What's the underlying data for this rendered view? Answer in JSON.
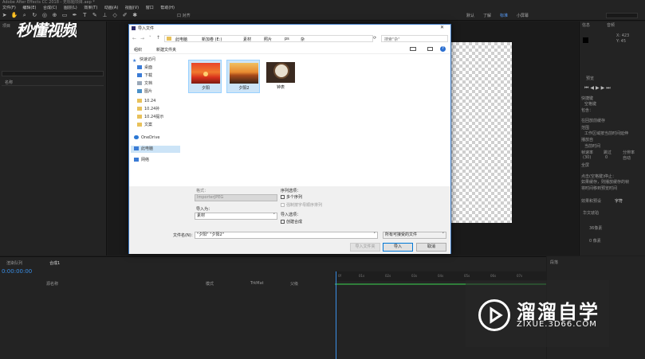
{
  "window": {
    "title": "Adobe After Effects CC 2018 - 无标题项目.aep *"
  },
  "menu": [
    "文件(F)",
    "编辑(E)",
    "合成(C)",
    "图层(L)",
    "效果(T)",
    "动画(A)",
    "视图(V)",
    "窗口",
    "帮助(H)"
  ],
  "toolbar": {
    "workspaces": [
      "默认",
      "了解",
      "标准",
      "小屏幕"
    ],
    "snap_label": "口 对齐"
  },
  "project_panel": {
    "tab": "项目",
    "name_header": "名称"
  },
  "right_panel": {
    "info_tab": "信息",
    "audio_tab": "音频",
    "info_x": "X: 423",
    "info_y": "Y: 45",
    "preview_tab": "预览",
    "shortcut_label": "快捷键",
    "shortcut_value": "空格键",
    "include_label": "包含：",
    "in_ram_label": "在回放前缓存",
    "range_label": "范围",
    "range_value": "工作区域按当前时间延伸",
    "play_from_label": "播放自",
    "play_from_value": "当前时间",
    "frame_rate_label": "帧速率",
    "skip_label": "跳过",
    "resolution_label": "分辨率",
    "fps_value": "(30)",
    "skip_value": "0",
    "res_value": "自动",
    "fullscreen_label": "全屏",
    "stop_label": "点击(空格键)停止：",
    "cache_label": "如果缓存，则播放缓存的帧",
    "move_time_label": "将时间移到预览时间",
    "effects_tab": "效果和预设",
    "char_tab": "字符",
    "font_value": "华文琥珀",
    "size_value": "36像素",
    "px_value": "0 像素"
  },
  "timeline": {
    "render_queue_tab": "渲染队列",
    "comp_tab": "合成1",
    "timecode": "0:00:00:00",
    "source_name": "源名称",
    "mode_label": "模式",
    "trkmat_label": "TrkMat",
    "parent_label": "父级",
    "ruler": [
      "0f",
      "01s",
      "02s",
      "03s",
      "04s",
      "05s",
      "06s",
      "07s"
    ]
  },
  "paragraph_panel": {
    "tab": "段落"
  },
  "dialog": {
    "title": "导入文件",
    "close": "✕",
    "breadcrumb": [
      "此电脑",
      "新加卷 (E:)",
      "素材",
      "照片",
      "ps",
      "杂"
    ],
    "search_placeholder": "搜索\"杂\"",
    "organize_label": "组织",
    "new_folder_label": "新建文件夹",
    "nav": [
      {
        "label": "快速访问",
        "icon": "star-icon"
      },
      {
        "label": "桌面",
        "icon": "desktop-icon"
      },
      {
        "label": "下载",
        "icon": "download-icon"
      },
      {
        "label": "文档",
        "icon": "document-icon"
      },
      {
        "label": "图片",
        "icon": "picture-icon"
      },
      {
        "label": "10.24",
        "icon": "folder-icon"
      },
      {
        "label": "10.24补",
        "icon": "folder-icon"
      },
      {
        "label": "10.24提示",
        "icon": "folder-icon"
      },
      {
        "label": "文案",
        "icon": "folder-icon"
      },
      {
        "label": "OneDrive",
        "icon": "cloud-icon"
      },
      {
        "label": "此电脑",
        "icon": "computer-icon"
      },
      {
        "label": "网络",
        "icon": "network-icon"
      }
    ],
    "files": [
      {
        "label": "夕阳",
        "icon": "sunset-thumbnail"
      },
      {
        "label": "夕阳2",
        "icon": "sunset2-thumbnail"
      },
      {
        "label": "钟表",
        "icon": "clock-thumbnail"
      }
    ],
    "format_label": "格式：",
    "format_value": "ImporterJPEG",
    "import_as_label": "导入为：",
    "import_as_value": "素材",
    "sequence_label": "序列选项：",
    "sequence_value": "多个序列",
    "alpha_sort_label": "强制按字母顺序排列",
    "import_options_label": "导入选项：",
    "create_comp_label": "创建合成",
    "filename_label": "文件名(N)：",
    "filename_value": "\"夕阳\" \"夕阳2\"",
    "filetype_value": "所有可接受的文件",
    "import_folder_button": "导入文件夹",
    "import_button": "导入",
    "cancel_button": "取消"
  },
  "watermark": {
    "top_logo": "秒懂视频",
    "brand": "溜溜自学",
    "url": "ZIXUE.3D66.COM"
  }
}
